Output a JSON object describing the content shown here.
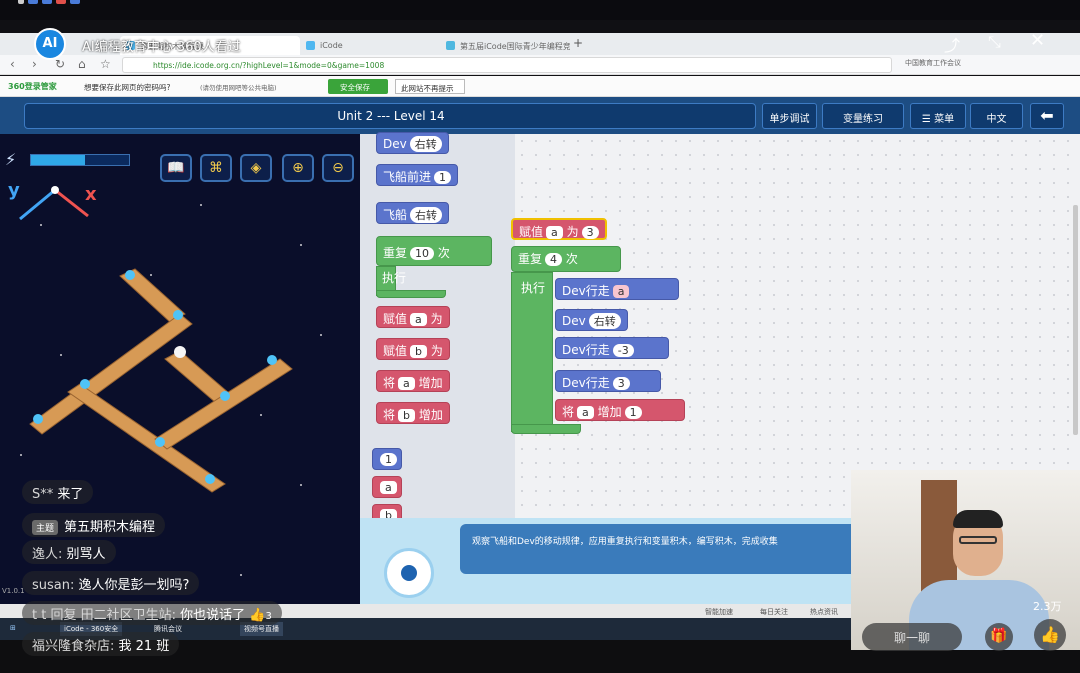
{
  "live": {
    "title": "AI编程教育中心",
    "viewers_text": "360人看过",
    "logo_text": "AI",
    "likes": "2.3万",
    "say_placeholder": "聊一聊",
    "like_count_chat": "3"
  },
  "browser": {
    "tabs": [
      "第五期积木编程课",
      "iCode",
      "第五届iCode国际青少年编程竞赛"
    ],
    "url": "https://ide.icode.org.cn/?highLevel=1&mode=0&game=1008",
    "right_text": "中国教育工作会议",
    "pwd_question": "想要保存此网页的密码吗?",
    "pwd_note": "(请勿使用网吧等公共电脑)",
    "pwd_save": "安全保存",
    "pwd_never": "此网站不再提示",
    "logo": "360登录管家"
  },
  "app": {
    "level_title": "Unit 2 --- Level 14",
    "btn_debug": "单步调试",
    "btn_var": "变量练习",
    "btn_menu": "菜单",
    "btn_lang": "中文"
  },
  "game": {
    "axis_y": "y",
    "axis_x": "x",
    "energy_fraction": 0.55,
    "version": "V1.0.1"
  },
  "palette": {
    "dev_turn": "Dev",
    "dev_turn_val": "右转",
    "ship_forward": "飞船前进",
    "ship_forward_val": "1",
    "ship_turn": "飞船",
    "ship_turn_val": "右转",
    "repeat": "重复",
    "repeat_val": "10",
    "repeat_unit": "次",
    "execute": "执行",
    "assign": "赋值",
    "assign_as": "为",
    "var_a": "a",
    "var_b": "b",
    "increase_prefix": "将",
    "increase": "增加",
    "num1": "1"
  },
  "workspace": {
    "assign": "赋值",
    "assign_var": "a",
    "assign_as": "为",
    "assign_val": "3",
    "repeat": "重复",
    "repeat_val": "4",
    "repeat_unit": "次",
    "execute": "执行",
    "dev_walk": "Dev行走",
    "dev_walk_var": "a",
    "dev": "Dev",
    "dev_turn_val": "右转",
    "dev_walk2_val": "-3",
    "dev_walk3_val": "3",
    "inc_prefix": "将",
    "inc_var": "a",
    "inc_label": "增加",
    "inc_val": "1"
  },
  "hint": {
    "text": "观察飞船和Dev的移动规律，应用重复执行和变量积木，编写积木，完成收集"
  },
  "chats": [
    {
      "nick": "S**",
      "msg": "来了"
    },
    {
      "nick": "主题",
      "msg": "第五期积木编程"
    },
    {
      "nick": "逸人:",
      "msg": "别骂人"
    },
    {
      "nick": "susan:",
      "msg": "逸人你是彭一划吗?"
    },
    {
      "nick": "t t 回复 田二社区卫生站:",
      "msg": "你也说话了"
    },
    {
      "nick": "福兴隆食杂店:",
      "msg": "我 21 班"
    }
  ],
  "footer": {
    "items": [
      "智能加速",
      "每日关注",
      "热点资讯"
    ],
    "taskbar": [
      "iCode - 360安全",
      "腾讯会议",
      "视频号直播"
    ]
  }
}
